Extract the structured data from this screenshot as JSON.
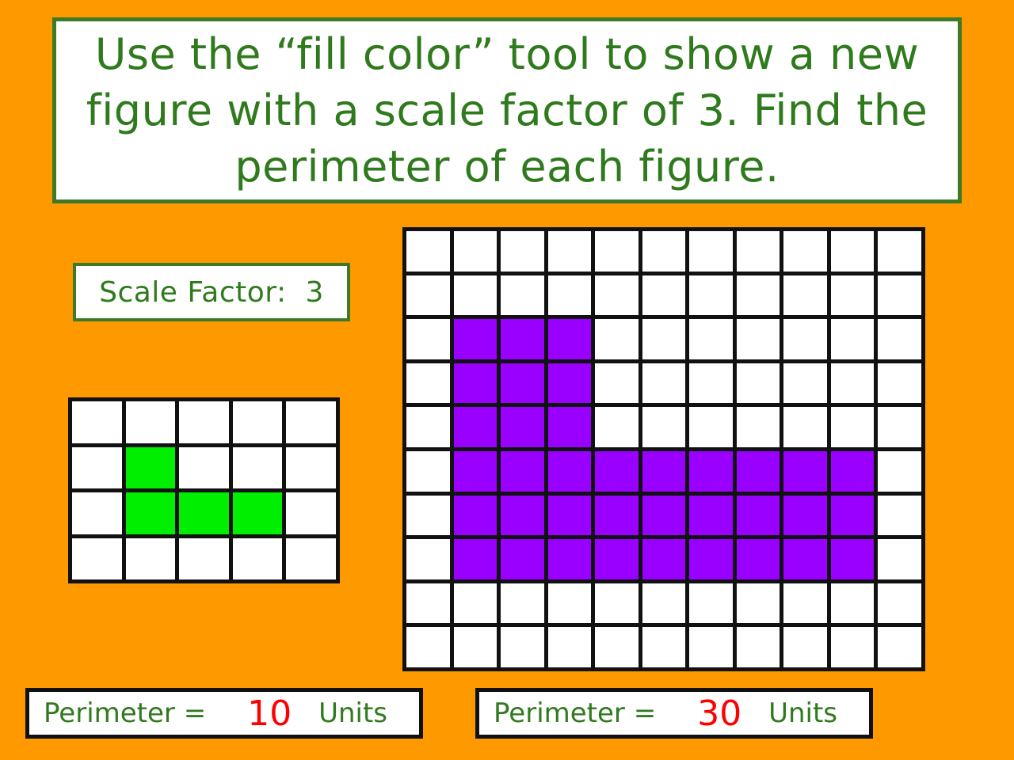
{
  "colors": {
    "background": "#ff9900",
    "heading_green": "#307a1e",
    "border_green": "#3c7a28",
    "grid_line": "#111111",
    "figure_green": "#00ee00",
    "figure_purple": "#9900ff",
    "answer_red": "#ff0000",
    "panel_white": "#ffffff"
  },
  "instruction": {
    "text": "Use the “fill color” tool to show a new figure with a scale factor of 3. Find the perimeter of each figure."
  },
  "scale_factor": {
    "label": "Scale Factor:  3",
    "value": 3
  },
  "small_figure": {
    "grid": {
      "columns": 5,
      "rows": 4
    },
    "fill_color_name": "green",
    "filled_cells": [
      [
        1,
        1
      ],
      [
        2,
        1
      ],
      [
        2,
        2
      ],
      [
        2,
        3
      ]
    ],
    "cell_count": 4
  },
  "large_figure": {
    "grid": {
      "columns": 11,
      "rows": 10
    },
    "fill_color_name": "purple",
    "filled_cells": [
      [
        2,
        1
      ],
      [
        2,
        2
      ],
      [
        2,
        3
      ],
      [
        3,
        1
      ],
      [
        3,
        2
      ],
      [
        3,
        3
      ],
      [
        4,
        1
      ],
      [
        4,
        2
      ],
      [
        4,
        3
      ],
      [
        5,
        1
      ],
      [
        5,
        2
      ],
      [
        5,
        3
      ],
      [
        5,
        4
      ],
      [
        5,
        5
      ],
      [
        5,
        6
      ],
      [
        5,
        7
      ],
      [
        5,
        8
      ],
      [
        5,
        9
      ],
      [
        6,
        1
      ],
      [
        6,
        2
      ],
      [
        6,
        3
      ],
      [
        6,
        4
      ],
      [
        6,
        5
      ],
      [
        6,
        6
      ],
      [
        6,
        7
      ],
      [
        6,
        8
      ],
      [
        6,
        9
      ],
      [
        7,
        1
      ],
      [
        7,
        2
      ],
      [
        7,
        3
      ],
      [
        7,
        4
      ],
      [
        7,
        5
      ],
      [
        7,
        6
      ],
      [
        7,
        7
      ],
      [
        7,
        8
      ],
      [
        7,
        9
      ]
    ],
    "cell_count": 36
  },
  "perimeter_small": {
    "label": "Perimeter =",
    "value": "10",
    "units": "Units"
  },
  "perimeter_large": {
    "label": "Perimeter =",
    "value": "30",
    "units": "Units"
  }
}
